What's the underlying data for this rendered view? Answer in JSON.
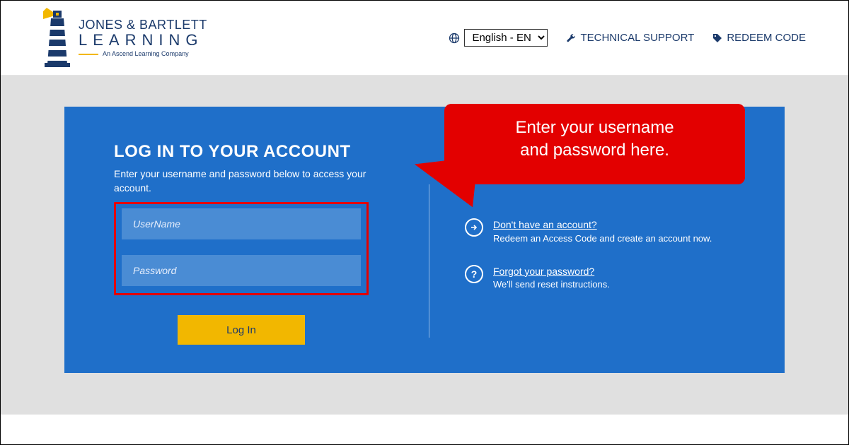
{
  "header": {
    "logo": {
      "line1": "JONES & BARTLETT",
      "line2": "LEARNING",
      "tagline": "An Ascend Learning Company"
    },
    "language": {
      "selected": "English - EN"
    },
    "tech_support": "TECHNICAL SUPPORT",
    "redeem_code": "REDEEM CODE"
  },
  "login": {
    "title": "LOG IN TO YOUR ACCOUNT",
    "subtitle": "Enter your username and password below to access your account.",
    "username_placeholder": "UserName",
    "password_placeholder": "Password",
    "button": "Log In"
  },
  "right": {
    "no_account": {
      "link": "Don't have an account?",
      "desc": "Redeem an Access Code and create an account now."
    },
    "forgot": {
      "link": "Forgot your password?",
      "desc": "We'll send reset instructions."
    }
  },
  "callout": {
    "line1": "Enter your username",
    "line2": "and password here."
  }
}
